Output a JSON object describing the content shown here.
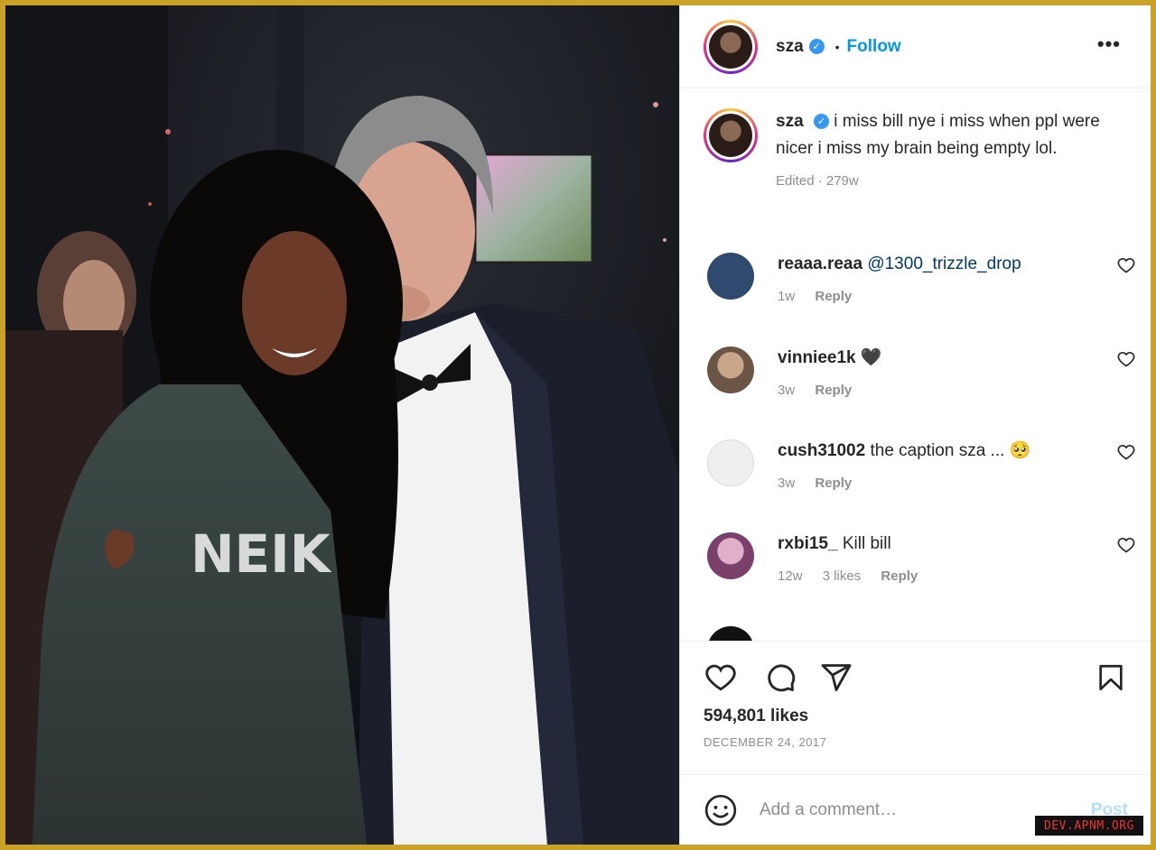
{
  "post": {
    "username": "sza",
    "follow_label": "Follow",
    "more_label": "•••",
    "caption": "i miss bill nye i miss when ppl were nicer i miss my brain being empty lol.",
    "caption_meta": "Edited · 279w",
    "photo_sweatshirt_text": "NEIK",
    "likes": "594,801 likes",
    "date": "DECEMBER 24, 2017"
  },
  "comments": [
    {
      "username": "reaaa.reaa",
      "text": "@1300_trizzle_drop",
      "age": "1w",
      "likes": "",
      "reply_label": "Reply",
      "avatar_color": "#2f4a6e"
    },
    {
      "username": "vinniee1k",
      "text": "🖤",
      "age": "3w",
      "likes": "",
      "reply_label": "Reply",
      "avatar_color": "#9a7b60"
    },
    {
      "username": "cush31002",
      "text": "the caption sza ... 🥺",
      "age": "3w",
      "likes": "",
      "reply_label": "Reply",
      "avatar_color": "#dbdbdb"
    },
    {
      "username": "rxbi15_",
      "text": "Kill bill",
      "age": "12w",
      "likes": "3 likes",
      "reply_label": "Reply",
      "avatar_color": "#b06a9a"
    }
  ],
  "add_comment": {
    "placeholder": "Add a comment…",
    "post_label": "Post"
  },
  "watermark": "DEV.APNM.ORG",
  "icons": [
    "verified-badge-icon",
    "more-options-icon",
    "heart-icon",
    "comment-icon",
    "share-icon",
    "bookmark-icon",
    "emoji-icon"
  ],
  "colors": {
    "frame": "#c9a227",
    "link": "#0095f6",
    "muted": "#8e8e8e",
    "verified": "#3897f0"
  }
}
